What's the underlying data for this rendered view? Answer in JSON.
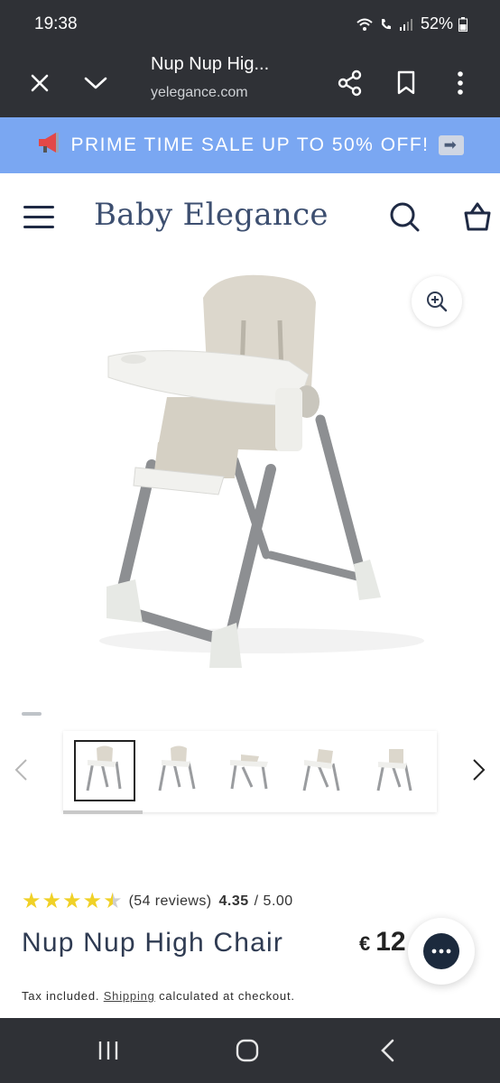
{
  "status_bar": {
    "time": "19:38",
    "battery": "52%"
  },
  "browser": {
    "page_title": "Nup Nup Hig...",
    "url": "yelegance.com"
  },
  "promo": {
    "text": "PRIME TIME SALE UP TO 50% OFF!"
  },
  "header": {
    "brand": "Baby Elegance"
  },
  "gallery": {
    "thumbnail_count": 5,
    "active_index": 0
  },
  "product": {
    "rating_value": 4.5,
    "reviews_text": "(54 reviews)",
    "score": "4.35",
    "out_of": "/ 5.00",
    "title": "Nup Nup High Chair",
    "currency": "€",
    "price": "12",
    "tax_prefix": "Tax included.",
    "shipping_link": "Shipping",
    "tax_suffix": "calculated at checkout."
  },
  "colors": {
    "promo_bg": "#7aa7f2",
    "brand_color": "#3d4f70",
    "star_color": "#f0d127",
    "system_bar": "#2f3136"
  }
}
